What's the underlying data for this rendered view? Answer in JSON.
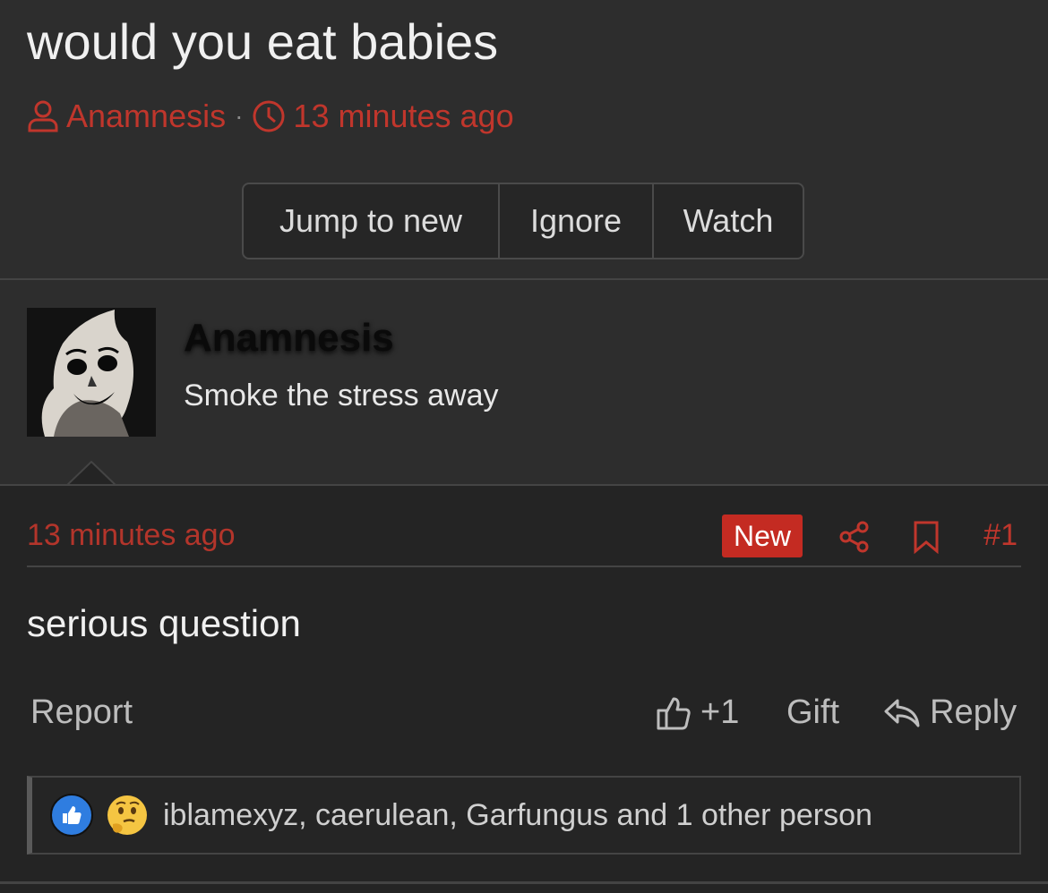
{
  "thread": {
    "title": "would you eat babies",
    "author": "Anamnesis",
    "separator": "·",
    "time_ago": "13 minutes ago"
  },
  "thread_actions": {
    "jump_to_new": "Jump to new",
    "ignore": "Ignore",
    "watch": "Watch"
  },
  "user": {
    "name": "Anamnesis",
    "title": "Smoke the stress away"
  },
  "post": {
    "time_ago": "13 minutes ago",
    "badge": "New",
    "number": "#1",
    "body": "serious question"
  },
  "post_actions": {
    "report": "Report",
    "like": "+1",
    "gift": "Gift",
    "reply": "Reply"
  },
  "reactions": {
    "text": "iblamexyz, caerulean, Garfungus and 1 other person",
    "emoji": [
      "thumbs-up",
      "thinking-face"
    ]
  },
  "colors": {
    "accent": "#c0362c",
    "badge": "#c42b22",
    "background": "#2b2b2b"
  }
}
